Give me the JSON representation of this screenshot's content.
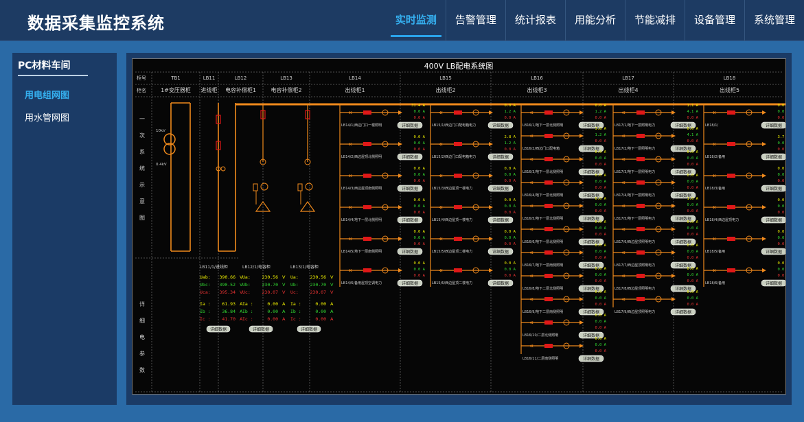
{
  "app": {
    "title": "数据采集监控系统"
  },
  "nav": {
    "tabs": [
      {
        "label": "实时监测",
        "active": true
      },
      {
        "label": "告警管理"
      },
      {
        "label": "统计报表"
      },
      {
        "label": "用能分析"
      },
      {
        "label": "节能减排"
      },
      {
        "label": "设备管理"
      },
      {
        "label": "系统管理"
      }
    ]
  },
  "sidebar": {
    "title": "PC材料车间",
    "items": [
      {
        "label": "用电组网图",
        "active": true
      },
      {
        "label": "用水管网图"
      }
    ]
  },
  "diagram": {
    "title": "400V LB配电系统图",
    "row_labels": {
      "cabinet_no": "柜号",
      "cabinet_name": "柜名"
    },
    "side_sections": {
      "primary": "一次系统示意图",
      "detail": "详细电参数"
    },
    "cabinets": [
      {
        "no": "TB1",
        "name": "1#变压器柜"
      },
      {
        "no": "LB11",
        "name": "进线柜"
      },
      {
        "no": "LB12",
        "name": "电容补偿柜1"
      },
      {
        "no": "LB13",
        "name": "电容补偿柜2"
      },
      {
        "no": "LB14",
        "name": "出线柜1"
      },
      {
        "no": "LB15",
        "name": "出线柜2"
      },
      {
        "no": "LB16",
        "name": "出线柜3"
      },
      {
        "no": "LB17",
        "name": "出线柜4"
      },
      {
        "no": "LB18",
        "name": "出线柜5"
      }
    ],
    "transformer": {
      "kv_high": "10kV",
      "kv_low": "0.4kV"
    },
    "detail_button": "详细数据",
    "detail_panels": [
      {
        "title": "LB11/1/进线柜",
        "rows": [
          {
            "label": "Uab:",
            "value": "390.66",
            "unit": "V",
            "color": "#f0f000"
          },
          {
            "label": "Ubc:",
            "value": "390.52",
            "unit": "V",
            "color": "#33dd33"
          },
          {
            "label": "Uca:",
            "value": "395.34",
            "unit": "V",
            "color": "#ee3333"
          },
          {
            "label": "Ia :",
            "value": "61.93",
            "unit": "A",
            "color": "#f0f000"
          },
          {
            "label": "Ib :",
            "value": "36.84",
            "unit": "A",
            "color": "#33dd33"
          },
          {
            "label": "Ic :",
            "value": "41.70",
            "unit": "A",
            "color": "#ee3333"
          }
        ]
      },
      {
        "title": "LB12/1/电容柜",
        "rows": [
          {
            "label": "Ua:",
            "value": "230.56",
            "unit": "V",
            "color": "#f0f000"
          },
          {
            "label": "Ub:",
            "value": "230.70",
            "unit": "V",
            "color": "#33dd33"
          },
          {
            "label": "Uc:",
            "value": "230.07",
            "unit": "V",
            "color": "#ee3333"
          },
          {
            "label": "Ia :",
            "value": "0.00",
            "unit": "A",
            "color": "#f0f000"
          },
          {
            "label": "Ib :",
            "value": "0.00",
            "unit": "A",
            "color": "#33dd33"
          },
          {
            "label": "Ic :",
            "value": "0.00",
            "unit": "A",
            "color": "#ee3333"
          }
        ]
      },
      {
        "title": "LB13/1/电容柜",
        "rows": [
          {
            "label": "Ua:",
            "value": "230.56",
            "unit": "V",
            "color": "#f0f000"
          },
          {
            "label": "Ub:",
            "value": "230.70",
            "unit": "V",
            "color": "#33dd33"
          },
          {
            "label": "Uc:",
            "value": "230.07",
            "unit": "V",
            "color": "#ee3333"
          },
          {
            "label": "Ia :",
            "value": "0.00",
            "unit": "A",
            "color": "#f0f000"
          },
          {
            "label": "Ib :",
            "value": "0.00",
            "unit": "A",
            "color": "#33dd33"
          },
          {
            "label": "Ic :",
            "value": "0.00",
            "unit": "A",
            "color": "#ee3333"
          }
        ]
      }
    ],
    "feeder_columns": [
      {
        "cabinet": "LB14",
        "feeders": [
          {
            "name": "LB14/1/西边门口一楼照明",
            "currents": [
              "31.4 A",
              "0.0 A",
              "0.0 A"
            ]
          },
          {
            "name": "LB14/2/西边屋顶北侧照明",
            "currents": [
              "0.0 A",
              "0.0 A",
              "0.0 A"
            ]
          },
          {
            "name": "LB14/3/西边屋顶南侧照明",
            "currents": [
              "0.0 A",
              "0.0 A",
              "0.0 A"
            ]
          },
          {
            "name": "LB14/4/地下一层北侧照明",
            "currents": [
              "0.0 A",
              "0.0 A",
              "0.0 A"
            ]
          },
          {
            "name": "LB14/5/地下一层南侧照明",
            "currents": [
              "0.0 A",
              "0.0 A",
              "0.0 A"
            ]
          },
          {
            "name": "LB14/6/备用屋顶空调电力",
            "currents": [
              "0.0 A",
              "0.0 A",
              "0.0 A"
            ]
          }
        ]
      },
      {
        "cabinet": "LB15",
        "feeders": [
          {
            "name": "LB15/1/西边门口配电箱电力",
            "currents": [
              "0.0 A",
              "1.2 A",
              "0.0 A"
            ]
          },
          {
            "name": "LB15/2/西边门口配电箱电力",
            "currents": [
              "2.8 A",
              "1.2 A",
              "0.0 A"
            ]
          },
          {
            "name": "LB15/3/西边屋顶一楼电力",
            "currents": [
              "0.0 A",
              "0.0 A",
              "0.0 A"
            ]
          },
          {
            "name": "LB15/4/西边屋顶一楼电力",
            "currents": [
              "0.0 A",
              "0.0 A",
              "0.0 A"
            ]
          },
          {
            "name": "LB15/5/西边屋顶二楼电力",
            "currents": [
              "0.0 A",
              "0.0 A",
              "0.0 A"
            ]
          },
          {
            "name": "LB15/6/西边屋顶二楼电力",
            "currents": [
              "0.0 A",
              "0.0 A",
              "0.0 A"
            ]
          }
        ]
      },
      {
        "cabinet": "LB16",
        "feeders": [
          {
            "name": "LB16/1/地下一层北侧照明",
            "currents": [
              "0.0 A",
              "1.2 A",
              "0.0 A"
            ]
          },
          {
            "name": "LB16/2/西边门口配电箱",
            "currents": [
              "3.8 A",
              "1.2 A",
              "0.0 A"
            ]
          },
          {
            "name": "LB16/3/地下一层北侧照明",
            "currents": [
              "0.0 A",
              "0.0 A",
              "0.0 A"
            ]
          },
          {
            "name": "LB16/4/地下一层北侧照明",
            "currents": [
              "0.0 A",
              "0.0 A",
              "0.0 A"
            ]
          },
          {
            "name": "LB16/5/地下一层北侧照明",
            "currents": [
              "0.0 A",
              "0.0 A",
              "0.0 A"
            ]
          },
          {
            "name": "LB16/6/地下一层北侧照明",
            "currents": [
              "0.0 A",
              "0.0 A",
              "0.0 A"
            ]
          },
          {
            "name": "LB16/7/地下一层南侧照明",
            "currents": [
              "0.0 A",
              "0.0 A",
              "0.0 A"
            ]
          },
          {
            "name": "LB16/8/地下二层北侧照明",
            "currents": [
              "0.0 A",
              "0.0 A",
              "0.0 A"
            ]
          },
          {
            "name": "LB16/9/地下二层南侧照明",
            "currents": [
              "0.0 A",
              "0.0 A",
              "0.0 A"
            ]
          },
          {
            "name": "LB16/10/二层北侧照明",
            "currents": [
              "0.0 A",
              "0.0 A",
              "0.0 A"
            ]
          },
          {
            "name": "LB16/11/二层南侧照明",
            "currents": [
              "0.0 A",
              "0.0 A",
              "0.0 A"
            ]
          }
        ]
      },
      {
        "cabinet": "LB17",
        "feeders": [
          {
            "name": "LB17/1/地下一层照明电力",
            "currents": [
              "1.1 A",
              "4.1 A",
              "0.0 A"
            ]
          },
          {
            "name": "LB17/2/地下一层照明电力",
            "currents": [
              "0.0 A",
              "4.1 A",
              "0.0 A"
            ]
          },
          {
            "name": "LB17/3/地下一层照明电力",
            "currents": [
              "0.0 A",
              "0.0 A",
              "0.0 A"
            ]
          },
          {
            "name": "LB17/4/地下一层照明电力",
            "currents": [
              "0.0 A",
              "0.0 A",
              "0.0 A"
            ]
          },
          {
            "name": "LB17/5/地下一层照明电力",
            "currents": [
              "1.0 A",
              "0.0 A",
              "0.0 A"
            ]
          },
          {
            "name": "LB17/6/西边屋顶照明电力",
            "currents": [
              "0.0 A",
              "0.0 A",
              "0.0 A"
            ]
          },
          {
            "name": "LB17/7/西边屋顶照明电力",
            "currents": [
              "0.0 A",
              "0.0 A",
              "0.0 A"
            ]
          },
          {
            "name": "LB17/8/西边屋顶照明电力",
            "currents": [
              "0.0 A",
              "0.0 A",
              "0.0 A"
            ]
          },
          {
            "name": "LB17/9/西边屋顶照明电力",
            "currents": [
              "0.0 A",
              "0.0 A",
              "0.0 A"
            ]
          }
        ]
      },
      {
        "cabinet": "LB18",
        "feeders": [
          {
            "name": "LB18/1/",
            "currents": [
              "0.0 A",
              "0.0 A",
              "0.0 A"
            ]
          },
          {
            "name": "LB18/2/备用",
            "currents": [
              "3.7 A",
              "0.0 A",
              "0.0 A"
            ]
          },
          {
            "name": "LB18/3/备用",
            "currents": [
              "0.0 A",
              "0.0 A",
              "0.0 A"
            ]
          },
          {
            "name": "LB18/4/西边屋顶电力",
            "currents": [
              "0.0 A",
              "0.0 A",
              "0.0 A"
            ]
          },
          {
            "name": "LB18/5/备用",
            "currents": [
              "0.0 A",
              "0.0 A",
              "0.0 A"
            ]
          },
          {
            "name": "LB18/6/备用",
            "currents": [
              "0.0 A",
              "0.0 A",
              "0.0 A"
            ]
          }
        ]
      }
    ],
    "colors": {
      "bus": "#f08a1c",
      "frame": "#9a9a9a",
      "text": "#d0d0d0",
      "phase_a": "#f0f000",
      "phase_b": "#33dd33",
      "phase_c": "#ee3333",
      "breaker": "#e01818",
      "button_bg": "#c9cfc0"
    }
  }
}
